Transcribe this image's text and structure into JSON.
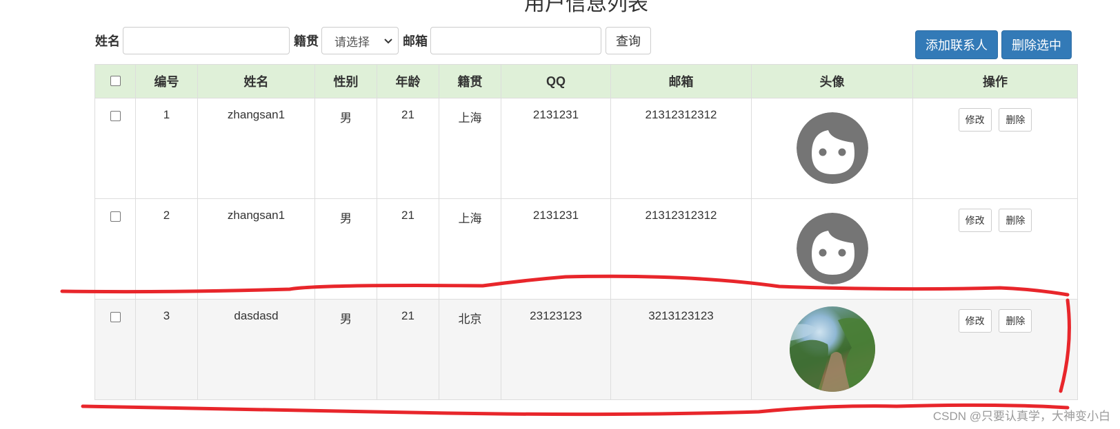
{
  "page_title": "用户信息列表",
  "search": {
    "name_label": "姓名",
    "name_value": "",
    "address_label": "籍贯",
    "address_selected": "请选择",
    "email_label": "邮箱",
    "email_value": "",
    "query_label": "查询"
  },
  "toolbar": {
    "add_label": "添加联系人",
    "delete_selected_label": "删除选中"
  },
  "table": {
    "headers": [
      "编号",
      "姓名",
      "性别",
      "年龄",
      "籍贯",
      "QQ",
      "邮箱",
      "头像",
      "操作"
    ],
    "rows": [
      {
        "id": "1",
        "name": "zhangsan1",
        "gender": "男",
        "age": "21",
        "address": "上海",
        "qq": "2131231",
        "email": "21312312312",
        "avatar": "default-face-icon"
      },
      {
        "id": "2",
        "name": "zhangsan1",
        "gender": "男",
        "age": "21",
        "address": "上海",
        "qq": "2131231",
        "email": "21312312312",
        "avatar": "default-face-icon"
      },
      {
        "id": "3",
        "name": "dasdasd",
        "gender": "男",
        "age": "21",
        "address": "北京",
        "qq": "23123123",
        "email": "3213123123",
        "avatar": "landscape-photo"
      }
    ],
    "edit_label": "修改",
    "delete_label": "删除"
  },
  "watermark": "CSDN @只要认真学，大神变小白",
  "colors": {
    "header_bg": "#dff0d8",
    "primary": "#337ab7",
    "annotation": "#e8262b",
    "avatar_gray": "#757575"
  }
}
